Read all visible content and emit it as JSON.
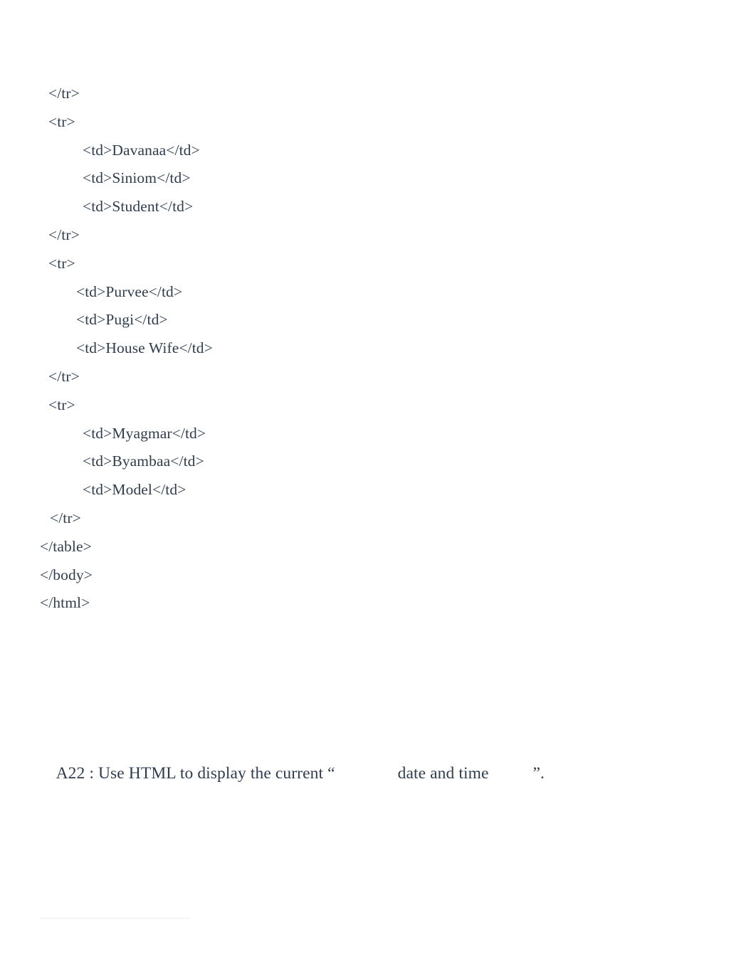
{
  "document": {
    "background_color": "#ffffff",
    "text_color": "#2f3d4e",
    "rule_color": "#f0f0f2"
  },
  "code_listing": {
    "lines": [
      {
        "text": "</tr>",
        "indent": "ind-1"
      },
      {
        "text": "<tr>",
        "indent": "ind-1"
      },
      {
        "text": "<td>Davanaa</td>",
        "indent": "ind-2"
      },
      {
        "text": "<td>Siniom</td>",
        "indent": "ind-2"
      },
      {
        "text": "<td>Student</td>",
        "indent": "ind-2"
      },
      {
        "text": "</tr>",
        "indent": "ind-1"
      },
      {
        "text": "<tr>",
        "indent": "ind-1"
      },
      {
        "text": "<td>Purvee</td>",
        "indent": "ind-2b"
      },
      {
        "text": "<td>Pugi</td>",
        "indent": "ind-2b"
      },
      {
        "text": "<td>House Wife</td>",
        "indent": "ind-2b"
      },
      {
        "text": "</tr>",
        "indent": "ind-1"
      },
      {
        "text": "<tr>",
        "indent": "ind-1"
      },
      {
        "text": "<td>Myagmar</td>",
        "indent": "ind-2"
      },
      {
        "text": "<td>Byambaa</td>",
        "indent": "ind-2"
      },
      {
        "text": "<td>Model</td>",
        "indent": "ind-2"
      },
      {
        "text": "</tr>",
        "indent": "ind-1b"
      },
      {
        "text": "</table>",
        "indent": "ind-0"
      },
      {
        "text": "</body>",
        "indent": "ind-0"
      },
      {
        "text": "</html>",
        "indent": "ind-0"
      }
    ]
  },
  "question": {
    "label": "A22",
    "part_1": " : Use HTML to display the current “",
    "part_2": "date and time",
    "part_3": "”.",
    "full_text": "A22  : Use HTML to display the current “          date and time        ”."
  }
}
